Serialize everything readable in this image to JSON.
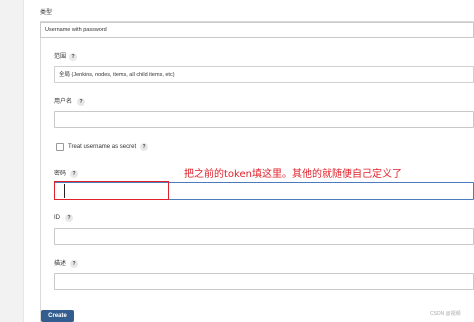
{
  "kind": {
    "label": "类型",
    "value": "Username with password"
  },
  "scope": {
    "label": "范围",
    "help": "?",
    "value": "全局 (Jenkins, nodes, items, all child items, etc)"
  },
  "username": {
    "label": "用户名",
    "help": "?",
    "value": ""
  },
  "treat_secret": {
    "label": "Treat username as secret",
    "help": "?",
    "checked": false
  },
  "password": {
    "label": "密码",
    "help": "?",
    "value": ""
  },
  "annotation": {
    "text": "把之前的token填这里。其他的就随便自己定义了",
    "color": "#e0202a"
  },
  "id_field": {
    "label": "ID",
    "help": "?",
    "value": ""
  },
  "description": {
    "label": "描述",
    "help": "?",
    "value": ""
  },
  "create_button": {
    "label": "Create"
  },
  "watermark": "CSDN @视频",
  "colors": {
    "button": "#335d8f",
    "focus_border": "#4b7bbd",
    "annotation": "#e0202a"
  }
}
